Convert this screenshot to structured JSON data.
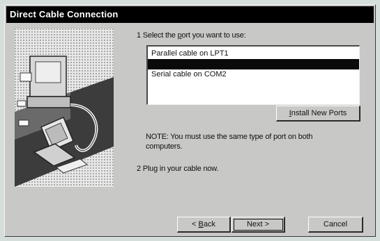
{
  "window": {
    "title": "Direct Cable Connection"
  },
  "step1": {
    "prefix": "1  Select the ",
    "underlined": "p",
    "suffix": "ort you want to use:"
  },
  "ports": [
    {
      "label": "Parallel cable on LPT1",
      "selected": false
    },
    {
      "label": "",
      "selected": true
    },
    {
      "label": "Serial cable on COM2",
      "selected": false
    }
  ],
  "install_button": {
    "underlined": "I",
    "rest": "nstall New Ports"
  },
  "note": {
    "line1": "NOTE: You must use the same type of port on both",
    "line2": "computers."
  },
  "step2": "2  Plug in your cable now.",
  "buttons": {
    "back": {
      "prefix": "< ",
      "underlined": "B",
      "rest": "ack"
    },
    "next": "Next >",
    "cancel": "Cancel"
  },
  "icons": [
    "desktop-computer-icon",
    "laptop-computer-icon",
    "cable-icon"
  ],
  "colors": {
    "titlebar": "#000000",
    "dialog_bg": "#c8c8c6",
    "list_selection": "#0a0a0a"
  }
}
